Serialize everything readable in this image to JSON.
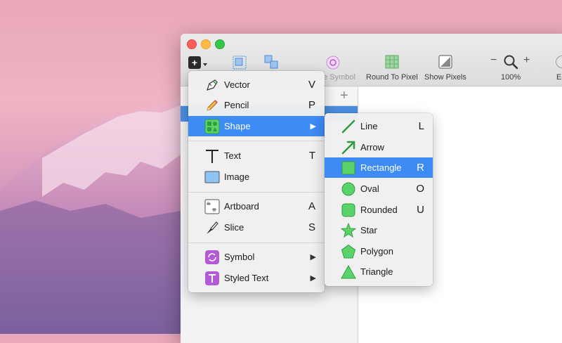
{
  "toolbar": {
    "items": [
      {
        "label": "te Symbol",
        "icon": "create-symbol-icon"
      },
      {
        "label": "Round To Pixel",
        "icon": "round-to-pixel-icon"
      },
      {
        "label": "Show Pixels",
        "icon": "show-pixels-icon"
      },
      {
        "label": "100%",
        "icon": "zoom-icon"
      },
      {
        "label": "Ed",
        "icon": "edit-icon"
      }
    ],
    "zoom_minus": "−",
    "zoom_plus": "+",
    "insert_button_glyph": "+"
  },
  "sidebar": {
    "add_glyph": "+"
  },
  "insert_menu": {
    "items": [
      {
        "label": "Vector",
        "key": "V",
        "icon": "vector-pen-icon"
      },
      {
        "label": "Pencil",
        "key": "P",
        "icon": "pencil-icon"
      },
      {
        "label": "Shape",
        "key": "",
        "submenu": "▶",
        "icon": "shape-icon",
        "selected": true
      },
      {
        "label": "Text",
        "key": "T",
        "icon": "text-icon"
      },
      {
        "label": "Image",
        "key": "",
        "icon": "image-icon"
      },
      {
        "label": "Artboard",
        "key": "A",
        "icon": "artboard-icon"
      },
      {
        "label": "Slice",
        "key": "S",
        "icon": "slice-knife-icon"
      },
      {
        "label": "Symbol",
        "key": "",
        "submenu": "▶",
        "icon": "symbol-icon"
      },
      {
        "label": "Styled Text",
        "key": "",
        "submenu": "▶",
        "icon": "styled-text-icon"
      }
    ]
  },
  "shape_menu": {
    "items": [
      {
        "label": "Line",
        "key": "L",
        "icon": "line-icon"
      },
      {
        "label": "Arrow",
        "key": "",
        "icon": "arrow-icon"
      },
      {
        "label": "Rectangle",
        "key": "R",
        "icon": "rectangle-icon",
        "selected": true
      },
      {
        "label": "Oval",
        "key": "O",
        "icon": "oval-icon"
      },
      {
        "label": "Rounded",
        "key": "U",
        "icon": "rounded-rect-icon"
      },
      {
        "label": "Star",
        "key": "",
        "icon": "star-icon"
      },
      {
        "label": "Polygon",
        "key": "",
        "icon": "polygon-icon"
      },
      {
        "label": "Triangle",
        "key": "",
        "icon": "triangle-icon"
      }
    ]
  },
  "colors": {
    "selection": "#3d8bf5",
    "shape_green": "#5bd36b",
    "shape_green_border": "#2f9c3f",
    "symbol_purple": "#b35bd6"
  }
}
